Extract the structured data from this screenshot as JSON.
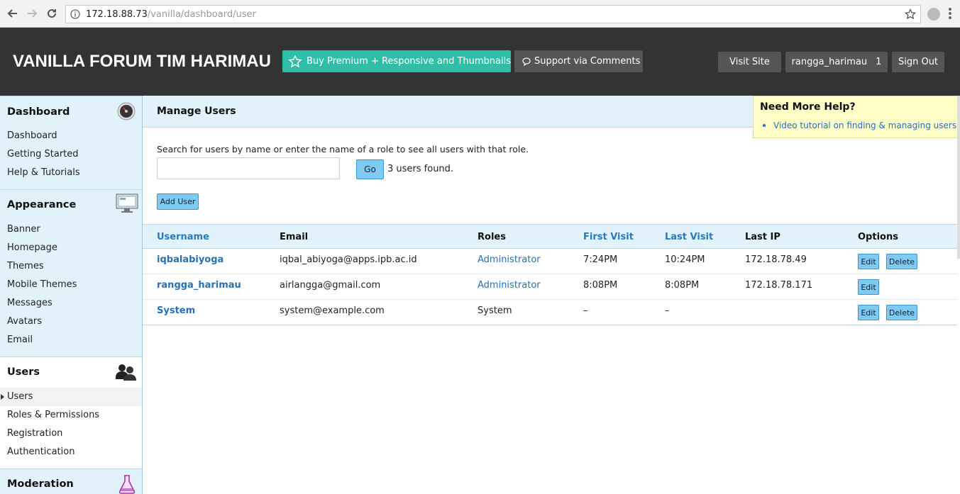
{
  "browser": {
    "url_host": "172.18.88.73",
    "url_path": "/vanilla/dashboard/user"
  },
  "header": {
    "site_title": "VANILLA FORUM TIM HARIMAU",
    "premium_label": "Buy Premium + Responsive and Thumbnails",
    "support_label": "Support via Comments",
    "visit_site_label": "Visit Site",
    "username": "rangga_harimau",
    "notification_count": "1",
    "sign_out_label": "Sign Out"
  },
  "sidebar": {
    "sections": [
      {
        "title": "Dashboard",
        "icon": "dashboard-gauge-icon",
        "items": [
          "Dashboard",
          "Getting Started",
          "Help & Tutorials"
        ]
      },
      {
        "title": "Appearance",
        "icon": "monitor-icon",
        "items": [
          "Banner",
          "Homepage",
          "Themes",
          "Mobile Themes",
          "Messages",
          "Avatars",
          "Email"
        ]
      },
      {
        "title": "Users",
        "icon": "users-icon",
        "items": [
          "Users",
          "Roles & Permissions",
          "Registration",
          "Authentication"
        ],
        "active": "Users"
      },
      {
        "title": "Moderation",
        "icon": "flask-icon",
        "items": []
      }
    ]
  },
  "main": {
    "title": "Manage Users",
    "search_description": "Search for users by name or enter the name of a role to see all users with that role.",
    "search_value": "",
    "go_label": "Go",
    "found_text": "3 users found.",
    "add_user_label": "Add User",
    "columns": [
      "Username",
      "Email",
      "Roles",
      "First Visit",
      "Last Visit",
      "Last IP",
      "Options"
    ],
    "rows": [
      {
        "username": "iqbalabiyoga",
        "email": "iqbal_abiyoga@apps.ipb.ac.id",
        "role": "Administrator",
        "first_visit": "7:24PM",
        "last_visit": "10:24PM",
        "last_ip": "172.18.78.49",
        "edit": "Edit",
        "delete": "Delete"
      },
      {
        "username": "rangga_harimau",
        "email": "airlangga@gmail.com",
        "role": "Administrator",
        "first_visit": "8:08PM",
        "last_visit": "8:08PM",
        "last_ip": "172.18.78.171",
        "edit": "Edit"
      },
      {
        "username": "System",
        "email": "system@example.com",
        "role": "System",
        "first_visit": "–",
        "last_visit": "–",
        "last_ip": "",
        "edit": "Edit",
        "delete": "Delete"
      }
    ]
  },
  "help": {
    "title": "Need More Help?",
    "link": "Video tutorial on finding & managing users"
  },
  "colors": {
    "header_bg": "#333333",
    "premium_bg": "#2fbfa6",
    "panel_bg": "#e2f2fb",
    "link": "#2a6fb0",
    "button_bg": "#7fcaf0",
    "help_bg": "#ffffc8"
  }
}
